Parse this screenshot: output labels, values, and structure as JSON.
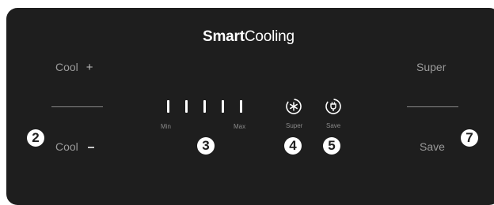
{
  "panel": {
    "title_bold": "Smart",
    "title_regular": "Cooling",
    "colors": {
      "panel": "#1e1e1e",
      "text": "#ffffff",
      "label": "#9a9a9a"
    }
  },
  "left_controls": {
    "cool_plus_label": "Cool",
    "plus_symbol": "+",
    "cool_minus_label": "Cool",
    "callout": "2"
  },
  "temperature_scale": {
    "min_label": "Min",
    "max_label": "Max",
    "bar_count": 5,
    "callout": "3"
  },
  "super_mode": {
    "icon": "snowflake-icon",
    "label": "Super",
    "callout": "4"
  },
  "save_mode": {
    "icon": "eco-plug-icon",
    "label": "Save",
    "callout": "5"
  },
  "right_controls": {
    "super_label": "Super",
    "save_label": "Save",
    "callout": "7"
  }
}
